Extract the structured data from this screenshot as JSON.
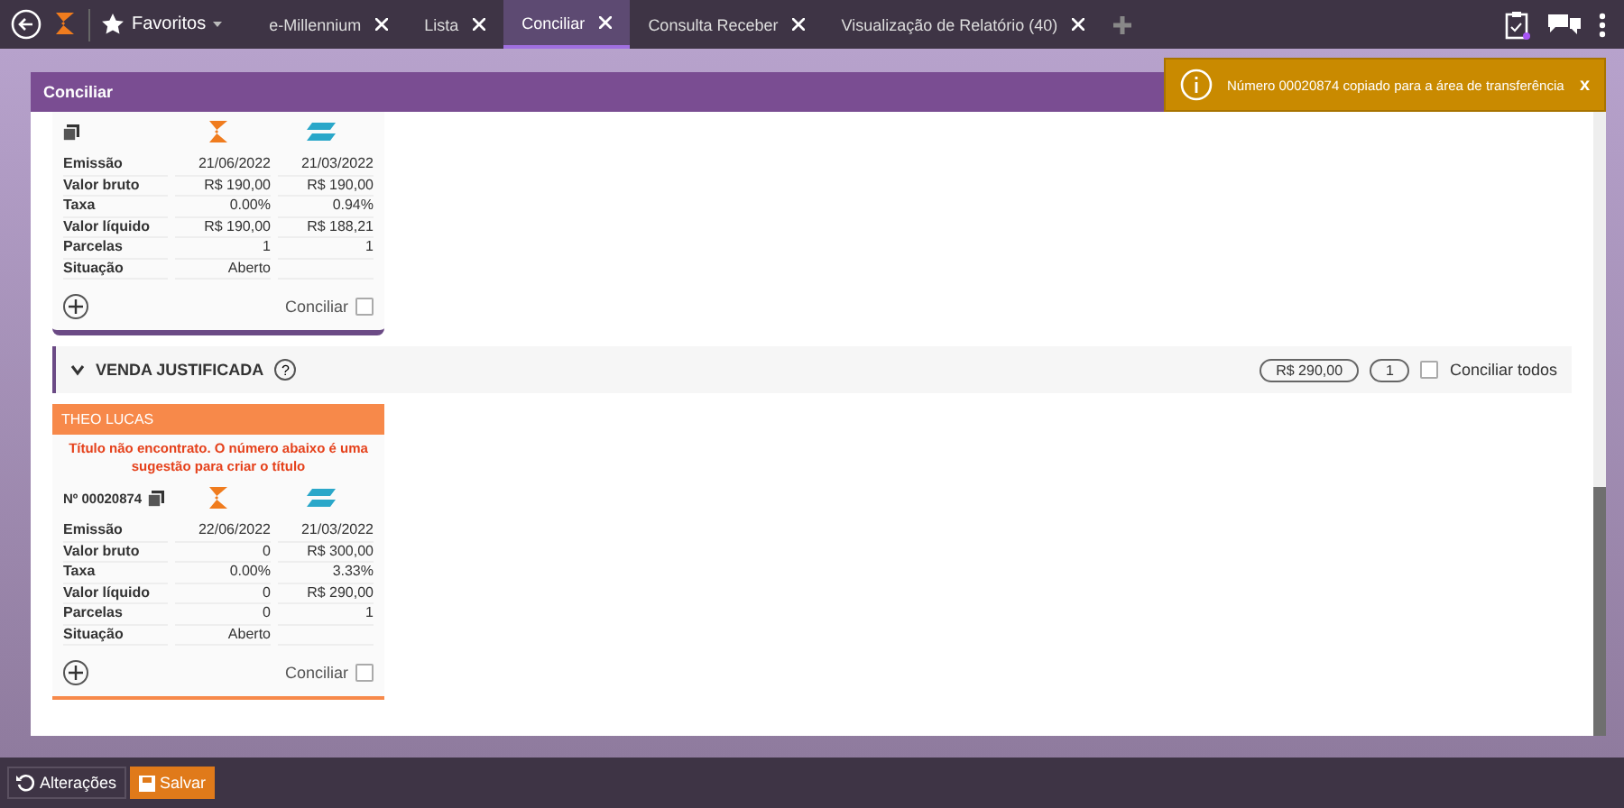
{
  "topbar": {
    "favorites": "Favoritos",
    "tabs": [
      {
        "label": "e-Millennium",
        "selected": false
      },
      {
        "label": "Lista",
        "selected": false
      },
      {
        "label": "Conciliar",
        "selected": true
      },
      {
        "label": "Consulta Receber",
        "selected": false
      },
      {
        "label": "Visualização de Relatório (40)",
        "selected": false
      }
    ]
  },
  "panel": {
    "title": "Conciliar",
    "cards": [
      {
        "kind": "found",
        "rows": [
          {
            "label": "Emissão",
            "value_1": "21/06/2022",
            "value_2": "21/03/2022"
          },
          {
            "label": "Valor bruto",
            "value_1": "R$ 190,00",
            "value_2": "R$ 190,00"
          },
          {
            "label": "Taxa",
            "value_1": "0.00%",
            "value_2": "0.94%"
          },
          {
            "label": "Valor líquido",
            "value_1": "R$ 190,00",
            "value_2": "R$ 188,21"
          },
          {
            "label": "Parcelas",
            "value_1": "1",
            "value_2": "1"
          },
          {
            "label": "Situação",
            "value_1": "Aberto",
            "value_2": ""
          }
        ],
        "action": "Conciliar",
        "checked": false
      },
      {
        "kind": "group",
        "title": "VENDA JUSTIFICADA",
        "expanded": true,
        "help": "?",
        "total": "R$ 290,00",
        "count": "1",
        "select_all": "Conciliar todos",
        "checked": false
      },
      {
        "kind": "missing",
        "header": "THEO LUCAS",
        "message": "Título não encontrato. O número abaixo é uma sugestão para criar o título",
        "number": "Nº 00020874",
        "rows": [
          {
            "label": "Emissão",
            "value_1": "22/06/2022",
            "value_2": "21/03/2022"
          },
          {
            "label": "Valor bruto",
            "value_1": "0",
            "value_2": "R$ 300,00"
          },
          {
            "label": "Taxa",
            "value_1": "0.00%",
            "value_2": "3.33%"
          },
          {
            "label": "Valor líquido",
            "value_1": "0",
            "value_2": "R$ 290,00"
          },
          {
            "label": "Parcelas",
            "value_1": "0",
            "value_2": "1"
          },
          {
            "label": "Situação",
            "value_1": "Aberto",
            "value_2": ""
          }
        ],
        "action": "Conciliar",
        "checked": false
      }
    ]
  },
  "toast": {
    "message": "Número 00020874 copiado para a área de transferência",
    "close": "x"
  },
  "footer": {
    "buttons": [
      {
        "label": "Alterações",
        "kind": "history"
      },
      {
        "label": "Salvar",
        "kind": "save"
      }
    ]
  }
}
